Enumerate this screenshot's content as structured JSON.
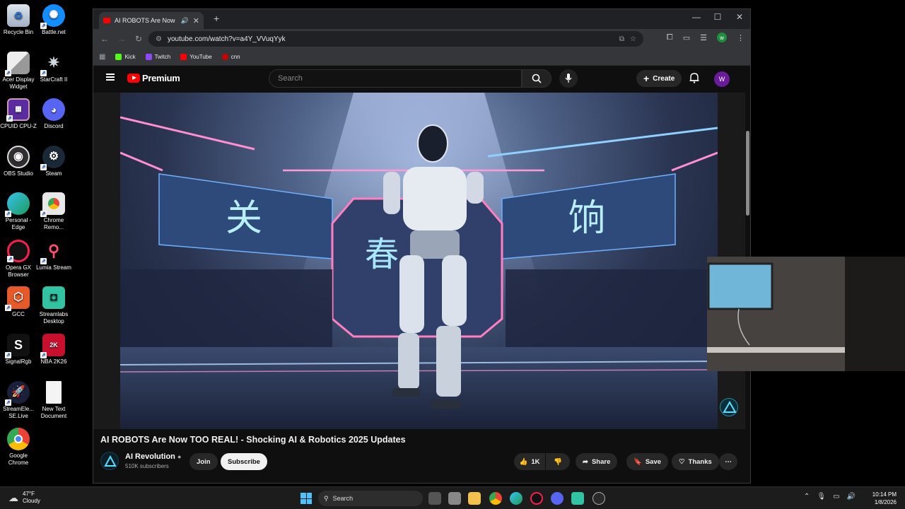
{
  "desktop": {
    "icons": [
      {
        "label": "Recycle Bin"
      },
      {
        "label": "Battle.net"
      },
      {
        "label": "Acer Display Widget"
      },
      {
        "label": "StarCraft II"
      },
      {
        "label": "CPUID CPU-Z"
      },
      {
        "label": "Discord"
      },
      {
        "label": "OBS Studio"
      },
      {
        "label": "Steam"
      },
      {
        "label": "Personal - Edge"
      },
      {
        "label": "Chrome Remo..."
      },
      {
        "label": "Opera GX Browser"
      },
      {
        "label": "Lumia Stream"
      },
      {
        "label": "GCC"
      },
      {
        "label": "Streamlabs Desktop"
      },
      {
        "label": "SignalRgb"
      },
      {
        "label": "NBA 2K26"
      },
      {
        "label": "StreamEle... SE.Live"
      },
      {
        "label": "New Text Document"
      },
      {
        "label": "Google Chrome"
      }
    ]
  },
  "browser": {
    "tab_title": "AI ROBOTS Are Now TOO R...",
    "address": "youtube.com/watch?v=a4Y_VVuqYyk",
    "profile_initial": "w",
    "bookmarks": [
      {
        "label": "Kick",
        "color": "#53fc18"
      },
      {
        "label": "Twitch",
        "color": "#9146ff"
      },
      {
        "label": "YouTube",
        "color": "#ff0000"
      },
      {
        "label": "cnn",
        "color": "#cc0000"
      }
    ]
  },
  "youtube": {
    "logo_text": "Premium",
    "search_placeholder": "Search",
    "create_label": "Create",
    "avatar_initial": "W",
    "video": {
      "title": "AI ROBOTS Are Now TOO REAL! - Shocking AI & Robotics 2025 Updates",
      "channel_name": "AI Revolution",
      "subscribers": "510K subscribers",
      "join_label": "Join",
      "subscribe_label": "Subscribe",
      "likes": "1K",
      "share_label": "Share",
      "save_label": "Save",
      "thanks_label": "Thanks",
      "sign_left": "关",
      "sign_center": "春",
      "sign_right": "饷"
    }
  },
  "taskbar": {
    "weather_temp": "47°F",
    "weather_desc": "Cloudy",
    "search_label": "Search",
    "time": "10:14 PM",
    "date": "1/8/2026"
  },
  "colors": {
    "youtube_red": "#ff0000",
    "subscribe_bg": "#f1f1f1",
    "avatar_purple": "#6a1b9a"
  }
}
